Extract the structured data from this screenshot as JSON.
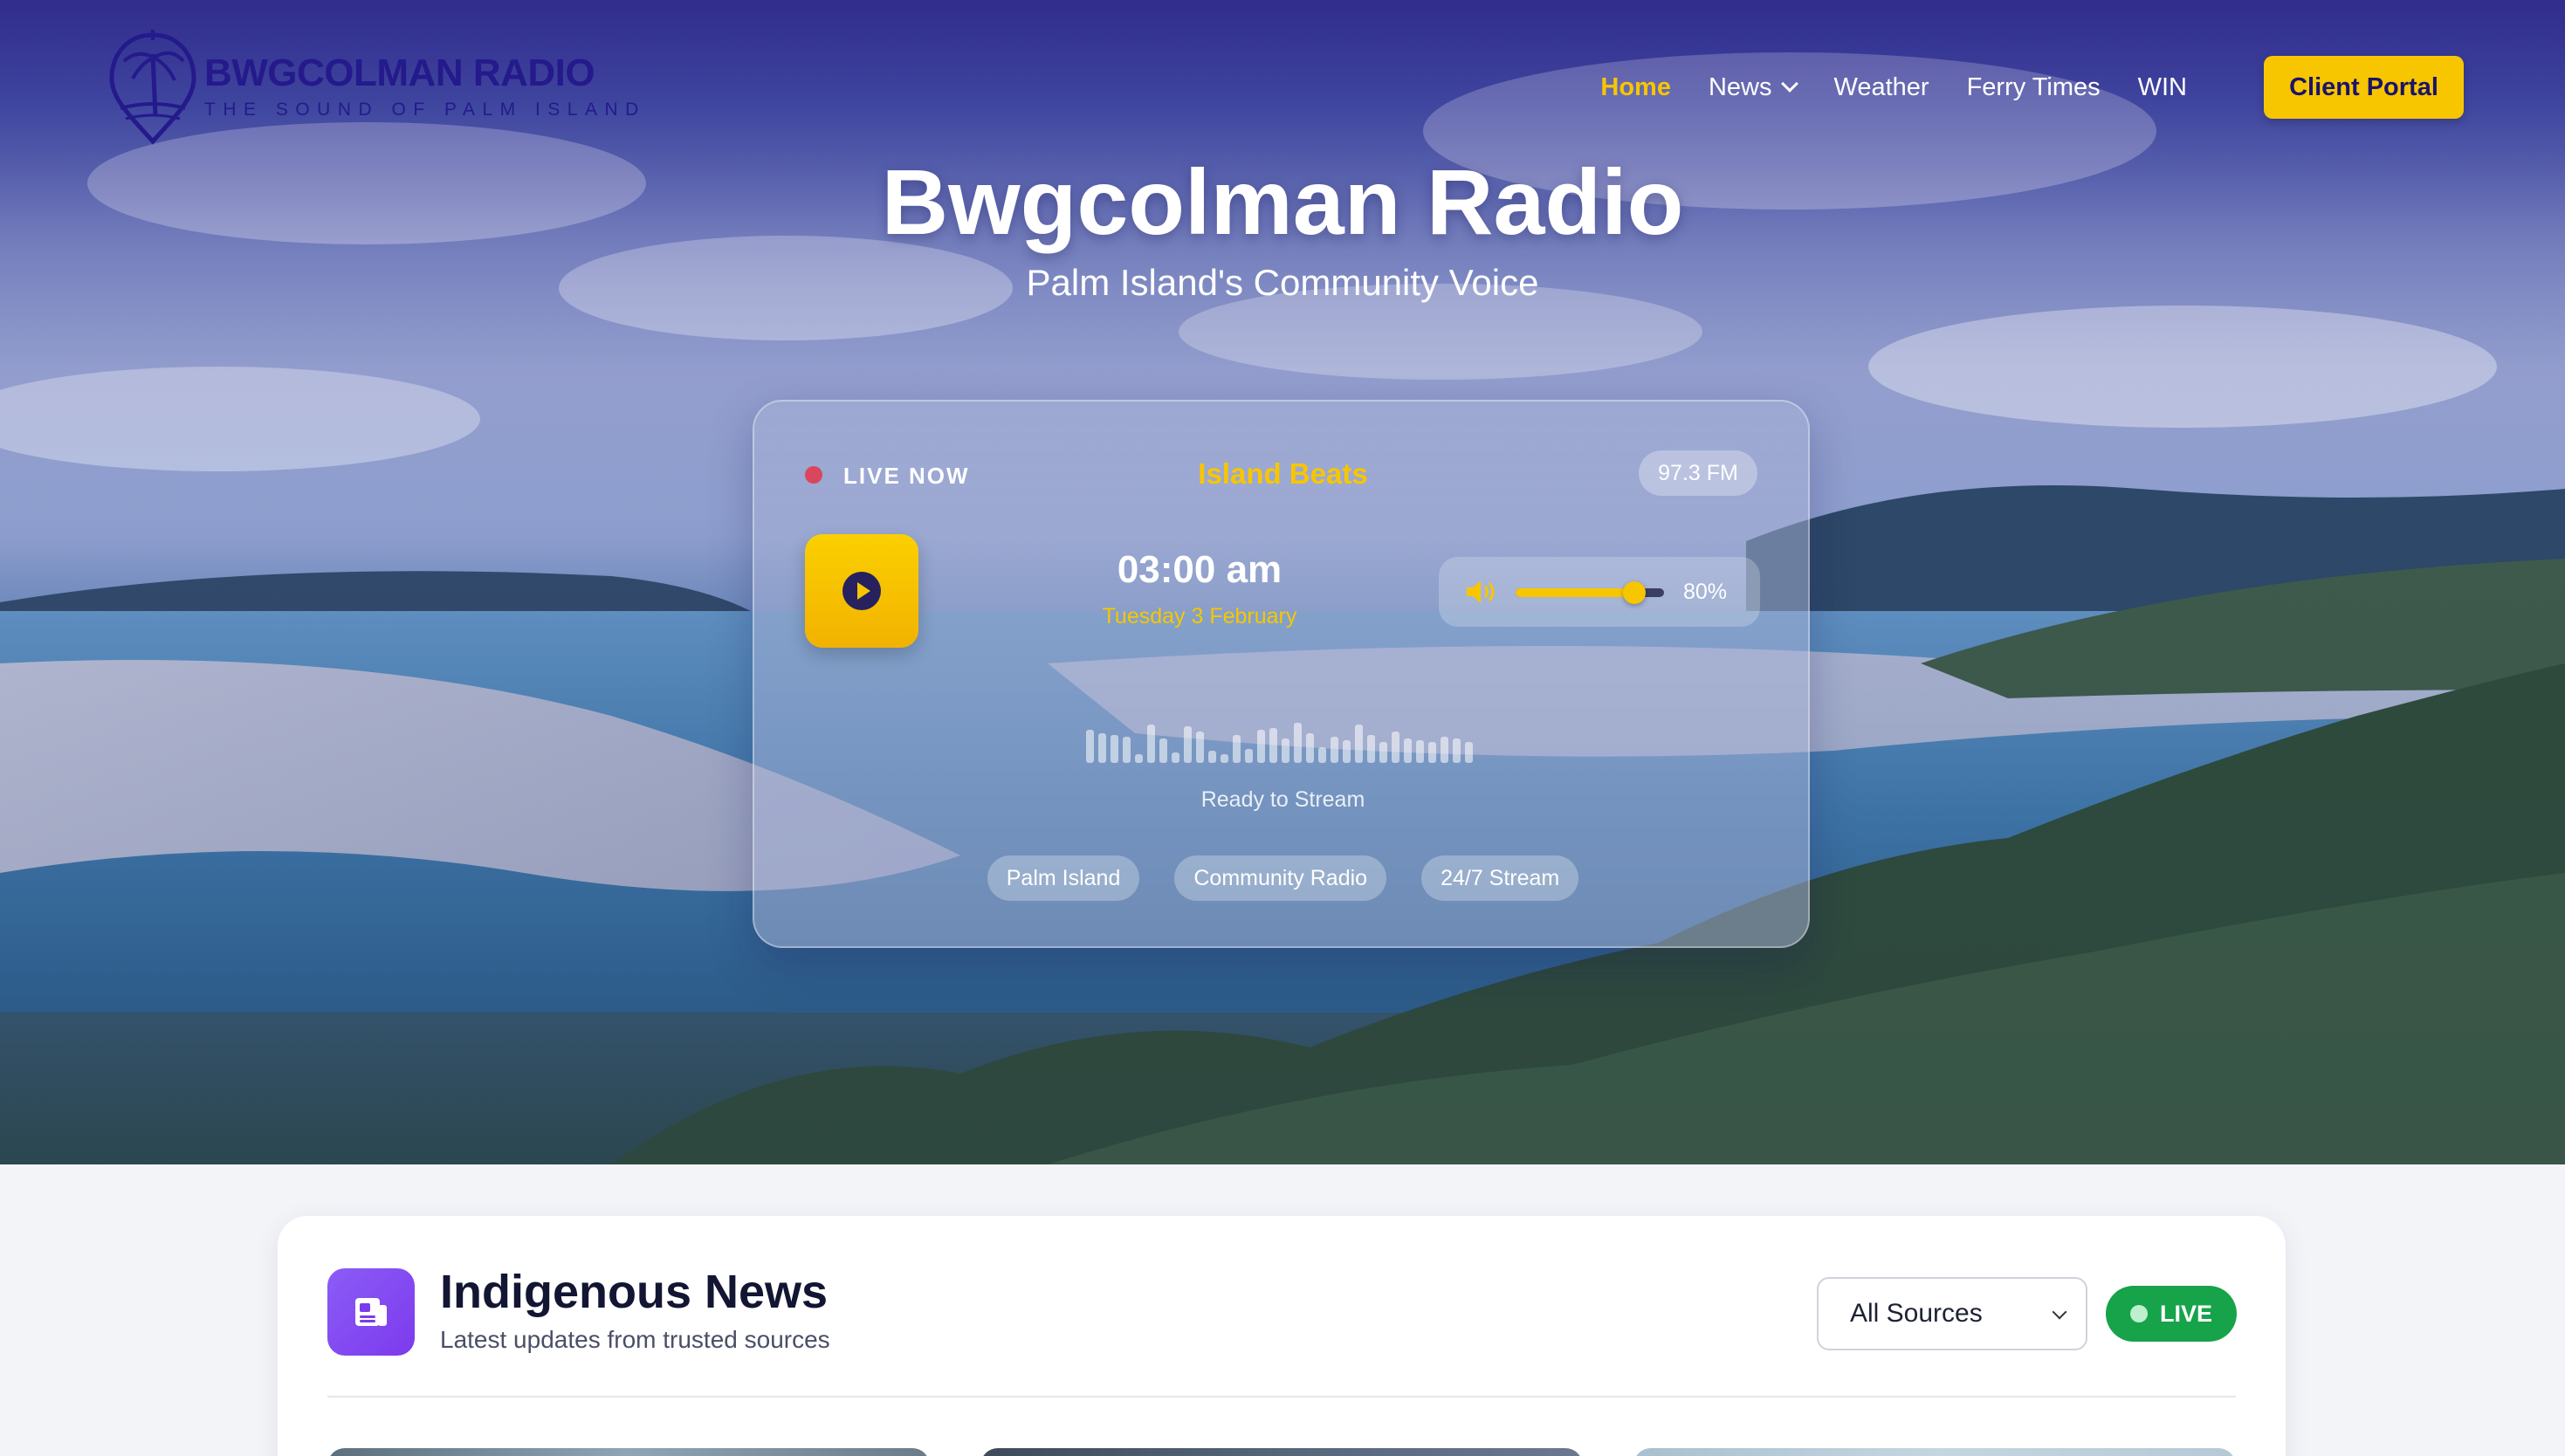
{
  "brand": {
    "name": "BWGCOLMAN RADIO",
    "tagline": "THE SOUND OF PALM ISLAND"
  },
  "nav": {
    "items": [
      {
        "label": "Home",
        "active": true
      },
      {
        "label": "News",
        "has_dropdown": true
      },
      {
        "label": "Weather"
      },
      {
        "label": "Ferry Times"
      },
      {
        "label": "WIN"
      }
    ],
    "cta_label": "Client Portal"
  },
  "hero": {
    "title": "Bwgcolman Radio",
    "subtitle": "Palm Island's Community Voice"
  },
  "player": {
    "live_label": "LIVE NOW",
    "show_name": "Island Beats",
    "frequency": "97.3 FM",
    "time": "03:00 am",
    "date": "Tuesday 3 February",
    "volume_label": "80%",
    "volume_level": 0.8,
    "status": "Ready to Stream",
    "tags": [
      "Palm Island",
      "Community Radio",
      "24/7 Stream"
    ],
    "icons": {
      "play": "play-icon",
      "volume": "speaker-icon"
    }
  },
  "news": {
    "title": "Indigenous News",
    "subtitle": "Latest updates from trusted sources",
    "source_selected": "All Sources",
    "live_label": "LIVE",
    "icon": "newspaper-icon"
  },
  "colors": {
    "accent": "#f7c600",
    "brand": "#241a8c",
    "live_green": "#16a34a",
    "news_icon": "#7c3aed"
  }
}
